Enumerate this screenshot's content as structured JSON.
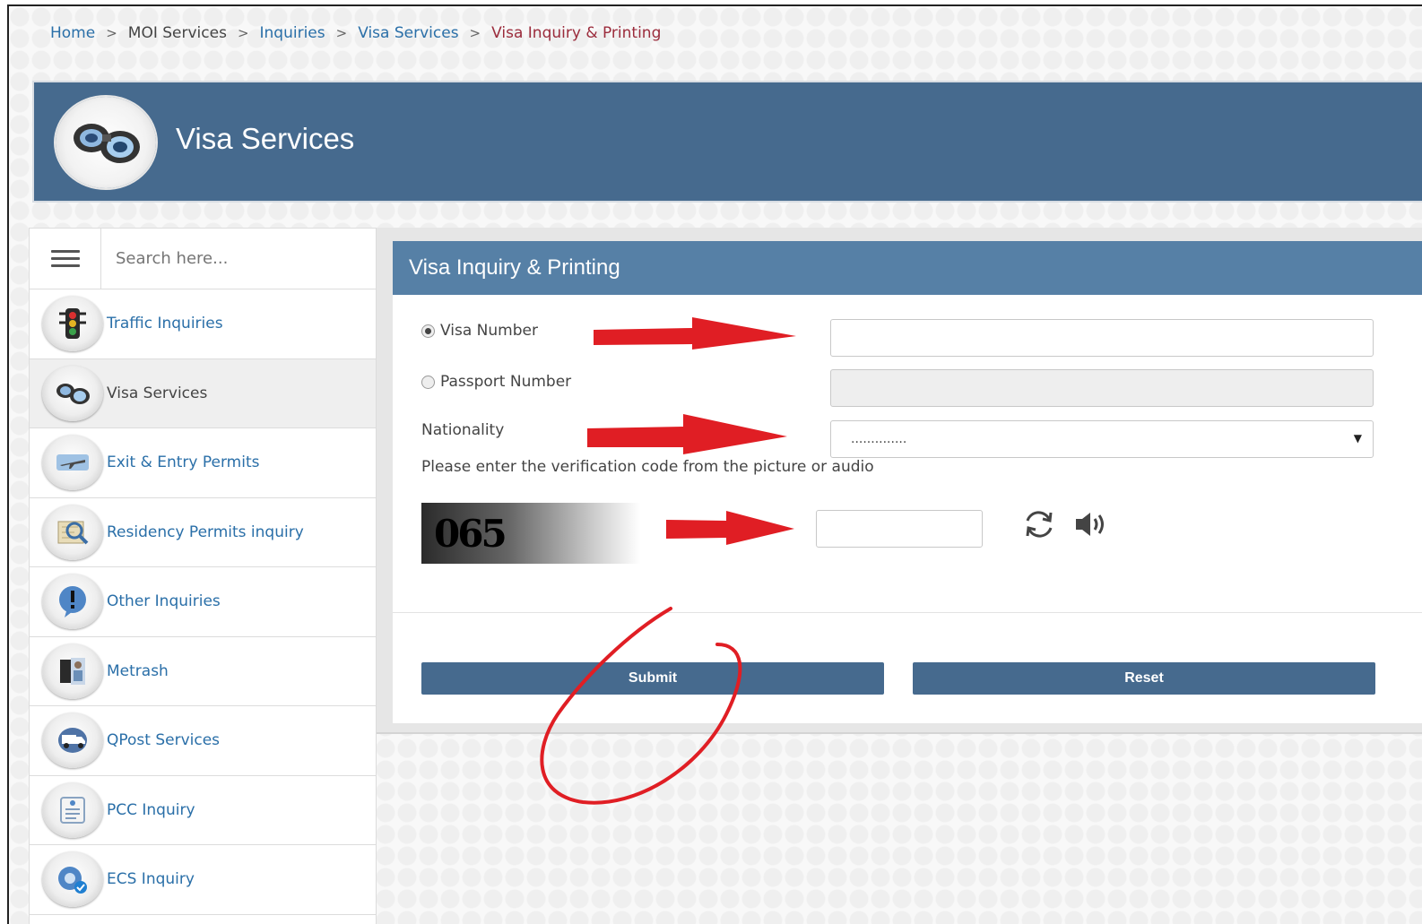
{
  "breadcrumb": {
    "home": "Home",
    "moi_services": "MOI Services",
    "inquiries": "Inquiries",
    "visa_services": "Visa Services",
    "current": "Visa Inquiry & Printing",
    "separator": ">"
  },
  "banner": {
    "title": "Visa Services",
    "icon": "binoculars-icon"
  },
  "sidebar": {
    "search_placeholder": "Search here...",
    "items": [
      {
        "label": "Traffic Inquiries",
        "icon": "traffic-light-icon",
        "active": false
      },
      {
        "label": "Visa Services",
        "icon": "binoculars-icon",
        "active": true
      },
      {
        "label": "Exit & Entry Permits",
        "icon": "airplane-icon",
        "active": false
      },
      {
        "label": "Residency Permits inquiry",
        "icon": "map-search-icon",
        "active": false
      },
      {
        "label": "Other Inquiries",
        "icon": "exclamation-icon",
        "active": false
      },
      {
        "label": "Metrash",
        "icon": "metrash-icon",
        "active": false
      },
      {
        "label": "QPost Services",
        "icon": "delivery-truck-icon",
        "active": false
      },
      {
        "label": "PCC Inquiry",
        "icon": "document-list-icon",
        "active": false
      },
      {
        "label": "ECS Inquiry",
        "icon": "ecs-badge-icon",
        "active": false
      }
    ]
  },
  "form": {
    "title": "Visa Inquiry & Printing",
    "visa_number_label": "Visa Number",
    "visa_number_selected": true,
    "visa_number_value": "",
    "passport_number_label": "Passport Number",
    "passport_number_selected": false,
    "nationality_label": "Nationality",
    "nationality_value": "..............",
    "captcha_instruction": "Please enter the verification code from the picture or audio",
    "captcha_text": "065",
    "captcha_value": "",
    "refresh_icon": "refresh-icon",
    "audio_icon": "speaker-icon",
    "submit_label": "Submit",
    "reset_label": "Reset"
  },
  "colors": {
    "banner": "#466a8e",
    "panel_header": "#5680a6",
    "link": "#2a6fa8",
    "current_crumb": "#9b2c3c",
    "annotation": "#e01e24"
  }
}
